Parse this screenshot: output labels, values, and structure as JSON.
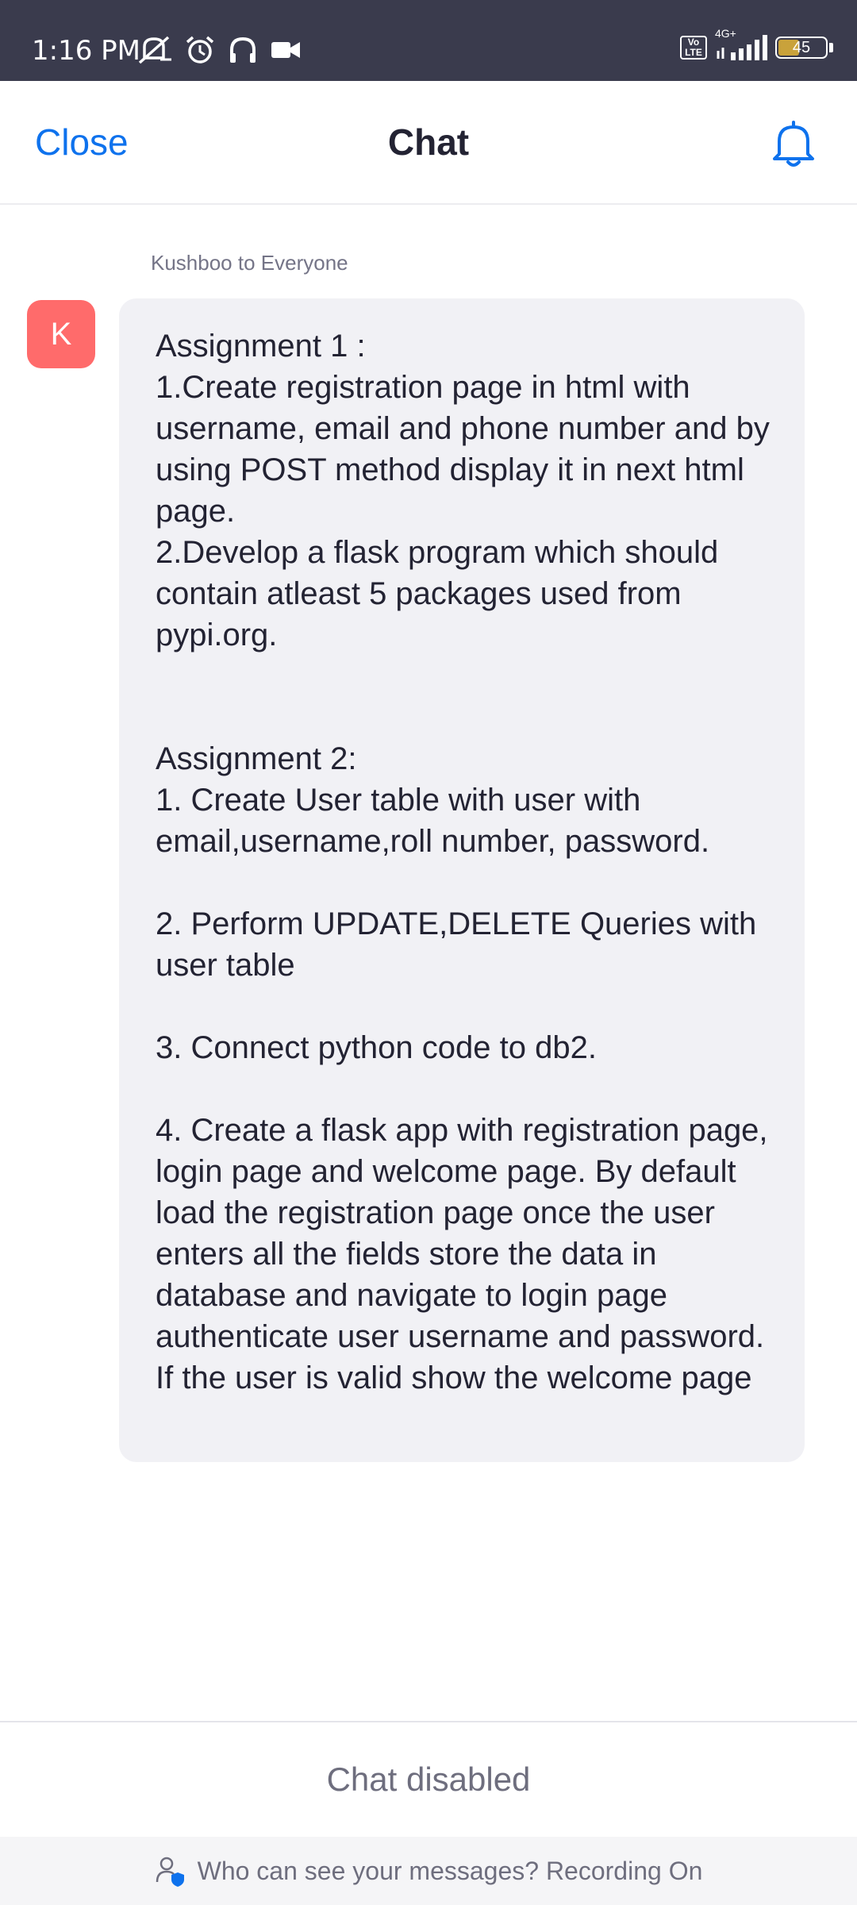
{
  "status_bar": {
    "time": "1:16 PM",
    "icons": [
      "mute-icon",
      "alarm-icon",
      "headphones-icon",
      "video-icon",
      "volte-icon",
      "signal-icon",
      "battery-icon"
    ],
    "volte_label": "Vo\nLTE",
    "network": "4G+",
    "battery": "45",
    "battery_level_percent": 45
  },
  "header": {
    "close_label": "Close",
    "title": "Chat",
    "accent_color": "#0e72ed"
  },
  "message": {
    "sender": "Kushboo to Everyone",
    "avatar_letter": "K",
    "avatar_color": "#ff6b6b",
    "text": "Assignment 1 :\n1.Create registration page in html with username, email and phone number and by using POST method display it in next html page.\n2.Develop a flask program which should contain atleast 5 packages used from pypi.org.\n\n\nAssignment 2:\n1. Create User table with user with email,username,roll number, password.\n\n2. Perform UPDATE,DELETE Queries with user table\n\n3. Connect python code to db2.\n\n4. Create a flask app with registration page, login page and welcome page. By default load the registration page once the user enters all the fields store the data in database and navigate to login page authenticate user username and password. If the user is valid show the welcome page"
  },
  "footer": {
    "status": "Chat disabled",
    "notice": "Who can see your messages? Recording On"
  }
}
